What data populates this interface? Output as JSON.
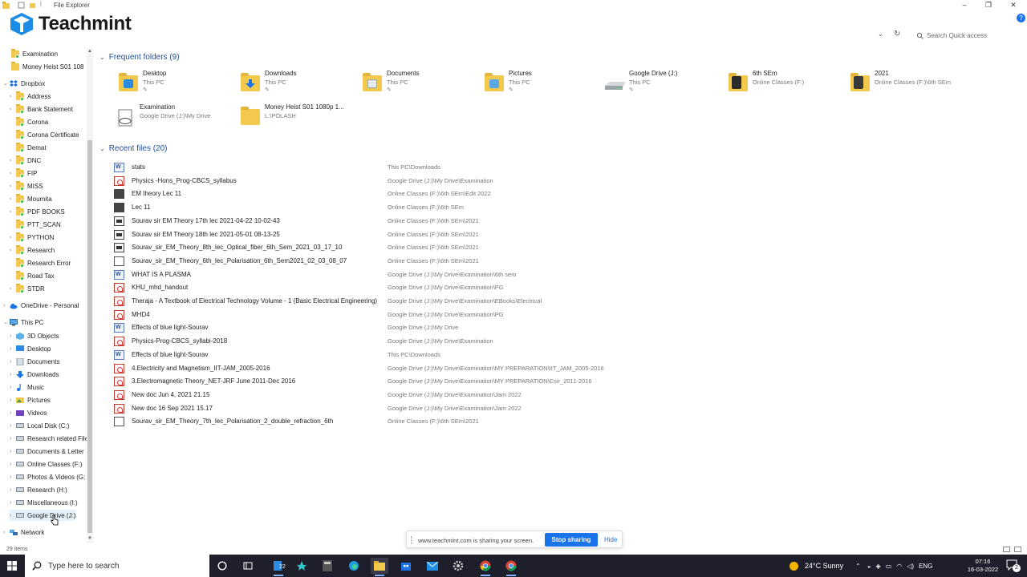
{
  "window": {
    "title": "File Explorer",
    "controls": [
      "–",
      "❐",
      "✕"
    ]
  },
  "brand": {
    "logo_text": "Teachmint",
    "accent": "#1a73e8"
  },
  "toolbar": {
    "search_placeholder": "Search Quick access"
  },
  "nav": {
    "quick_items": [
      {
        "label": "Examination"
      },
      {
        "label": "Money Heist S01 108"
      }
    ],
    "dropbox": {
      "label": "Dropbox",
      "items": [
        {
          "label": "Address"
        },
        {
          "label": "Bank Statement"
        },
        {
          "label": "Corona"
        },
        {
          "label": "Corona Certificate"
        },
        {
          "label": "Demat"
        },
        {
          "label": "DNC"
        },
        {
          "label": "FIP"
        },
        {
          "label": "MISS"
        },
        {
          "label": "Moumita"
        },
        {
          "label": "PDF BOOKS"
        },
        {
          "label": "PTT_SCAN"
        },
        {
          "label": "PYTHON"
        },
        {
          "label": "Research"
        },
        {
          "label": "Research Error"
        },
        {
          "label": "Road Tax"
        },
        {
          "label": "STDR"
        }
      ]
    },
    "onedrive": {
      "label": "OneDrive - Personal"
    },
    "thispc": {
      "label": "This PC",
      "items": [
        {
          "label": "3D Objects"
        },
        {
          "label": "Desktop"
        },
        {
          "label": "Documents"
        },
        {
          "label": "Downloads"
        },
        {
          "label": "Music"
        },
        {
          "label": "Pictures"
        },
        {
          "label": "Videos"
        },
        {
          "label": "Local Disk (C:)"
        },
        {
          "label": "Research related File"
        },
        {
          "label": "Documents & Letter"
        },
        {
          "label": "Online Classes (F:)"
        },
        {
          "label": "Photos & Videos (G:"
        },
        {
          "label": "Research (H:)"
        },
        {
          "label": "Miscellaneous (I:)"
        },
        {
          "label": "Google Drive (J:)"
        }
      ]
    },
    "network": {
      "label": "Network"
    }
  },
  "frequent": {
    "heading": "Frequent folders (9)",
    "folders": [
      {
        "name": "Desktop",
        "path": "This PC",
        "pinned": true,
        "badge": "desktop"
      },
      {
        "name": "Downloads",
        "path": "This PC",
        "pinned": true,
        "badge": "download"
      },
      {
        "name": "Documents",
        "path": "This PC",
        "pinned": true,
        "badge": "document"
      },
      {
        "name": "Pictures",
        "path": "This PC",
        "pinned": true,
        "badge": "picture"
      },
      {
        "name": "Google Drive (J:)",
        "path": "This PC",
        "pinned": true,
        "badge": "drive"
      },
      {
        "name": "6th SEm",
        "path": "Online Classes (F:)",
        "pinned": false,
        "badge": "dark"
      },
      {
        "name": "2021",
        "path": "Online Classes (F:)\\6th SEm",
        "pinned": false,
        "badge": "dark"
      },
      {
        "name": "Examination",
        "path": "Google Drive (J:)\\My Drive",
        "pinned": false,
        "badge": "cloud"
      },
      {
        "name": "Money Heist S01 1080p 1...",
        "path": "L:\\POLASH",
        "pinned": false,
        "badge": "plain"
      }
    ]
  },
  "recent": {
    "heading": "Recent files (20)",
    "files": [
      {
        "name": "stats",
        "location": "This PC\\Downloads",
        "type": "word"
      },
      {
        "name": "Physics -Hons_Prog-CBCS_syllabus",
        "location": "Google Drive (J:)\\My Drive\\Examination",
        "type": "pdf"
      },
      {
        "name": "EM theory Lec 11",
        "location": "Online Classes (F:)\\6th SEm\\Edit 2022",
        "type": "dark"
      },
      {
        "name": "Lec 11",
        "location": "Online Classes (F:)\\6th SEm",
        "type": "dark"
      },
      {
        "name": "Sourav sir EM Theory 17th lec 2021-04-22 10-02-43",
        "location": "Online Classes (F:)\\6th SEm\\2021",
        "type": "video"
      },
      {
        "name": "Sourav sir EM Theory 18th lec 2021-05-01 08-13-25",
        "location": "Online Classes (F:)\\6th SEm\\2021",
        "type": "video"
      },
      {
        "name": "Sourav_sir_EM_Theory_8th_lec_Optical_fiber_6th_Sem_2021_03_17_10",
        "location": "Online Classes (F:)\\6th SEm\\2021",
        "type": "video"
      },
      {
        "name": "Sourav_sir_EM_Theory_6th_lec_Polarisation_6th_Sem2021_02_03_08_07",
        "location": "Online Classes (F:)\\6th SEm\\2021",
        "type": "blank"
      },
      {
        "name": "WHAT IS A PLASMA",
        "location": "Google Drive (J:)\\My Drive\\Examination\\6th sem",
        "type": "word"
      },
      {
        "name": "KHU_mhd_handout",
        "location": "Google Drive (J:)\\My Drive\\Examination\\PG",
        "type": "pdf"
      },
      {
        "name": "Theraja - A Textbook of Electrical Technology Volume - 1 (Basic Electrical Engineering)",
        "location": "Google Drive (J:)\\My Drive\\Examination\\EBooks\\Electrical",
        "type": "pdf"
      },
      {
        "name": "MHD4",
        "location": "Google Drive (J:)\\My Drive\\Examination\\PG",
        "type": "pdf"
      },
      {
        "name": "Effects of blue light-Sourav",
        "location": "Google Drive (J:)\\My Drive",
        "type": "word"
      },
      {
        "name": "Physics-Prog-CBCS_syllabi-2018",
        "location": "Google Drive (J:)\\My Drive\\Examination",
        "type": "pdf"
      },
      {
        "name": "Effects of blue light-Sourav",
        "location": "This PC\\Downloads",
        "type": "word"
      },
      {
        "name": "4.Electricity and Magnetism_IIT-JAM_2005-2016",
        "location": "Google Drive (J:)\\My Drive\\Examination\\MY PREPARATION\\IIT_JAM_2005-2016",
        "type": "pdf"
      },
      {
        "name": "3.Electromagnetic Theory_NET-JRF June 2011-Dec 2016",
        "location": "Google Drive (J:)\\My Drive\\Examination\\MY PREPARATION\\Csir_2011-2016",
        "type": "pdf"
      },
      {
        "name": "New doc Jun 4, 2021 21.15",
        "location": "Google Drive (J:)\\My Drive\\Examination\\Jam 2022",
        "type": "pdf"
      },
      {
        "name": "New doc 16 Sep 2021 15.17",
        "location": "Google Drive (J:)\\My Drive\\Examination\\Jam 2022",
        "type": "pdf"
      },
      {
        "name": "Sourav_sir_EM_Theory_7th_lec_Polarisation_2_double_refraction_6th",
        "location": "Online Classes (F:)\\6th SEm\\2021",
        "type": "blank"
      }
    ]
  },
  "share_bar": {
    "message": "www.teachmint.com is sharing your screen.",
    "stop_label": "Stop sharing",
    "hide_label": "Hide"
  },
  "status": {
    "item_count": "29 items"
  },
  "taskbar": {
    "search_placeholder": "Type here to search",
    "badge_count": "22",
    "weather": "24°C  Sunny",
    "language": "ENG",
    "time": "07:16",
    "date": "16-03-2022",
    "notification_count": "2"
  }
}
